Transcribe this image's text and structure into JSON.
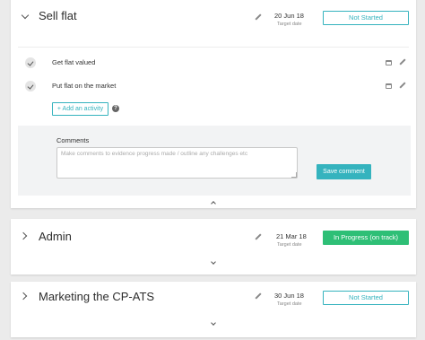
{
  "goals": [
    {
      "title": "Sell flat",
      "date": "20 Jun 18",
      "date_label": "Target date",
      "status": "Not Started",
      "activities": [
        {
          "label": "Get flat valued"
        },
        {
          "label": "Put flat on the market"
        }
      ],
      "add_activity_label": "+ Add an activity",
      "comments_label": "Comments",
      "comments_placeholder": "Make comments to evidence progress made / outline any challenges etc",
      "save_label": "Save comment"
    },
    {
      "title": "Admin",
      "date": "21 Mar 18",
      "date_label": "Target date",
      "status": "In Progress (on track)"
    },
    {
      "title": "Marketing the CP-ATS",
      "date": "30 Jun 18",
      "date_label": "Target date",
      "status": "Not Started"
    }
  ],
  "colors": {
    "accent": "#35b3be",
    "in_progress": "#2ebf76",
    "background": "#ebebeb"
  }
}
